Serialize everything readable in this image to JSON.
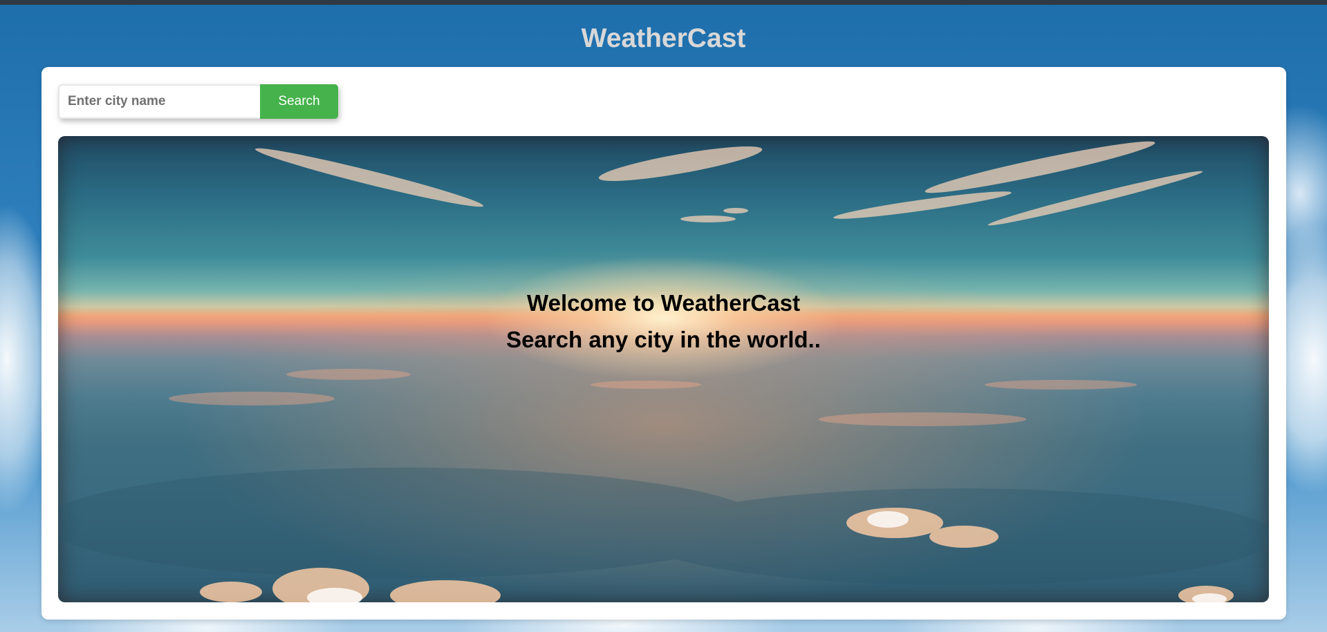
{
  "app": {
    "title": "WeatherCast"
  },
  "search": {
    "placeholder": "Enter city name",
    "value": "",
    "button_label": "Search"
  },
  "hero": {
    "welcome_line": "Welcome to WeatherCast",
    "subtitle_line": "Search any city in the world.."
  },
  "colors": {
    "page_background": "#2f80bd",
    "title_text": "#d8d8d8",
    "search_button": "#45b24b",
    "card": "#ffffff"
  }
}
